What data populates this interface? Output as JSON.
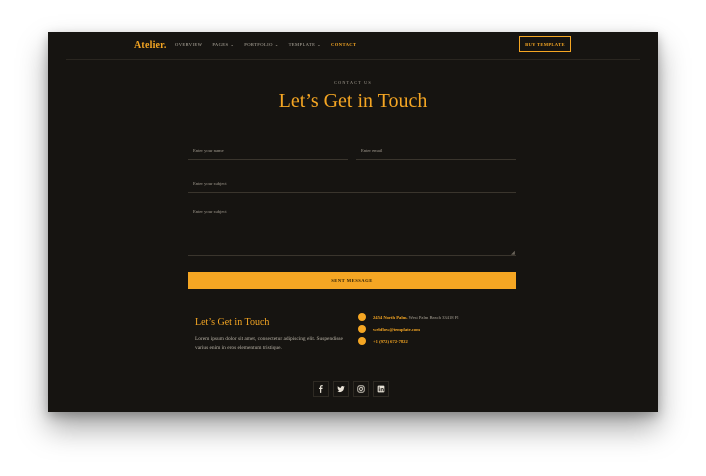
{
  "nav": {
    "logo": "Atelier.",
    "items": [
      {
        "label": "OVERVIEW",
        "dropdown": false,
        "active": false
      },
      {
        "label": "PAGES",
        "dropdown": true,
        "active": false
      },
      {
        "label": "PORTFOLIO",
        "dropdown": true,
        "active": false
      },
      {
        "label": "TEMPLATE",
        "dropdown": true,
        "active": false
      },
      {
        "label": "CONTACT",
        "dropdown": false,
        "active": true
      }
    ],
    "cta": "BUY TEMPLATE"
  },
  "hero": {
    "eyebrow": "CONTACT US",
    "title": "Let’s Get in Touch"
  },
  "form": {
    "name_placeholder": "Enter your name",
    "email_placeholder": "Enter email",
    "subject_placeholder": "Enter your subject",
    "message_placeholder": "Enter your subject",
    "submit_label": "SENT MESSAGE"
  },
  "info": {
    "title": "Let’s Get in Touch",
    "description": "Lorem ipsum dolor sit amet, consectetur adipiscing elit. Suspendisse varius enim in eros elementum tristique.",
    "address_bold": "2454 North Palm.",
    "address_rest": " West Palm Beach 33418 Fl",
    "email": "webflow@template.com",
    "phone": "+1 (972) 672-7822"
  },
  "social": [
    "facebook-icon",
    "twitter-icon",
    "instagram-icon",
    "linkedin-icon"
  ],
  "colors": {
    "accent": "#f5a623",
    "background": "#161411"
  }
}
